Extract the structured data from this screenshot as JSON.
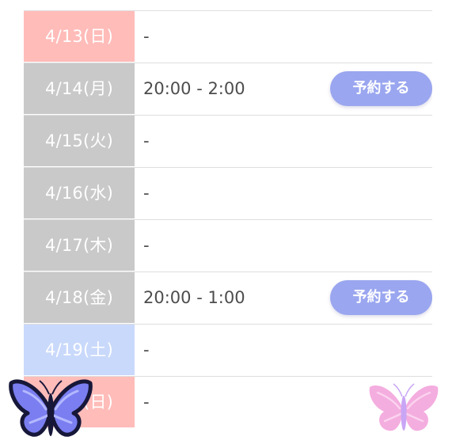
{
  "schedule": {
    "rows": [
      {
        "date": "4/13(日)",
        "time": "-",
        "date_bg": "#ffbcb9"
      },
      {
        "date": "4/14(月)",
        "time": "20:00 - 2:00",
        "date_bg": "#c9c9c9",
        "button": "予約する"
      },
      {
        "date": "4/15(火)",
        "time": "-",
        "date_bg": "#c9c9c9"
      },
      {
        "date": "4/16(水)",
        "time": "-",
        "date_bg": "#c9c9c9"
      },
      {
        "date": "4/17(木)",
        "time": "-",
        "date_bg": "#c9c9c9"
      },
      {
        "date": "4/18(金)",
        "time": "20:00 - 1:00",
        "date_bg": "#c9c9c9",
        "button": "予約する"
      },
      {
        "date": "4/19(土)",
        "time": "-",
        "date_bg": "#c9d9fb"
      },
      {
        "date": "4/20(日)",
        "time": "-",
        "date_bg": "#ffbcb9"
      }
    ]
  },
  "decorations": {
    "left_butterfly_icon": "blue-butterfly-icon",
    "right_butterfly_icon": "pink-butterfly-icon",
    "left_butterfly_color": "#7a7ef0",
    "right_butterfly_color": "#f3a6dc"
  }
}
